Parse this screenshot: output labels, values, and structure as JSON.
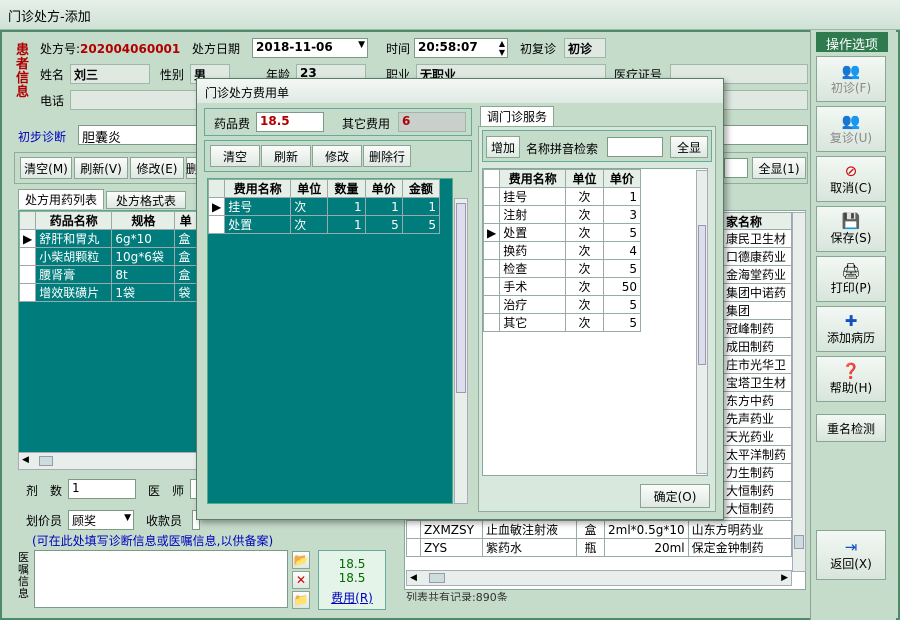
{
  "window": {
    "title": "门诊处方-添加"
  },
  "patient_info_vertical": "患者信息",
  "header": {
    "rx_no_label": "处方号:",
    "rx_no": "202004060001",
    "date_label": "处方日期",
    "date": "2018-11-06",
    "time_label": "时间",
    "time": "20:58:07",
    "visit_type_label": "初复诊",
    "visit_type": "初诊",
    "name_label": "姓名",
    "name": "刘三",
    "gender_label": "性别",
    "gender": "男",
    "age_label": "年龄",
    "age": "23",
    "job_label": "职业",
    "job": "无职业",
    "med_card_label": "医疗证号",
    "phone_label": "电话"
  },
  "diagnosis": {
    "label": "初步诊断",
    "value": "胆囊炎"
  },
  "main_toolbar": {
    "clear": "清空(M)",
    "refresh": "刷新(V)",
    "edit": "修改(E)",
    "more": "删",
    "show_all": "全显(1)"
  },
  "tabs": [
    "处方用药列表",
    "处方格式表"
  ],
  "drug_table": {
    "headers": [
      "药品名称",
      "规格",
      "单"
    ],
    "rows": [
      [
        "舒肝和胃丸",
        "6g*10",
        "盒"
      ],
      [
        "小柴胡颗粒",
        "10g*6袋",
        "盒"
      ],
      [
        "腰肾膏",
        "8t",
        "盒"
      ],
      [
        "增效联磺片",
        "1袋",
        "袋"
      ]
    ]
  },
  "bottom_form": {
    "dose_label": "剂　数",
    "dose": "1",
    "doctor_label": "医　师",
    "pricer_label": "划价员",
    "pricer": "顾奖",
    "cashier_label": "收款员"
  },
  "hint": "(可在此处填写诊断信息或医嘱信息,以供备案)",
  "advice_label": "医嘱信息",
  "fee_summary": {
    "line1": "18.5",
    "line2": "18.5",
    "button": "费用(R)"
  },
  "right_table": {
    "header_partial": "家名称",
    "vendor_rows": [
      "康民卫生材",
      "口德康药业",
      "金海堂药业",
      "集团中诺药",
      "集团",
      "冠峰制药",
      "成田制药",
      "庄市光华卫",
      "宝塔卫生材",
      "东方中药",
      "先声药业",
      "天光药业",
      "太平洋制药",
      "力生制药",
      "大恒制药",
      "大恒制药"
    ],
    "full_rows": [
      {
        "code": "ZXMZSY",
        "name": "止血敏注射液",
        "unit": "盒",
        "spec": "2ml*0.5g*10",
        "vendor": "山东方明药业"
      },
      {
        "code": "ZYS",
        "name": "紫药水",
        "unit": "瓶",
        "spec": "20ml",
        "vendor": "保定金钟制药"
      }
    ],
    "footer": "列表共有记录:890条"
  },
  "side_panel": {
    "title": "操作选项",
    "buttons": [
      {
        "label": "初诊(F)",
        "icon": "people-icon",
        "enabled": false
      },
      {
        "label": "复诊(U)",
        "icon": "people-icon",
        "enabled": false
      },
      {
        "label": "取消(C)",
        "icon": "cancel-icon",
        "enabled": true
      },
      {
        "label": "保存(S)",
        "icon": "save-icon",
        "enabled": true
      },
      {
        "label": "打印(P)",
        "icon": "printer-icon",
        "enabled": true
      },
      {
        "label": "添加病历",
        "icon": "plus-icon",
        "enabled": true
      },
      {
        "label": "帮助(H)",
        "icon": "help-icon",
        "enabled": true
      },
      {
        "label": "重名检测",
        "icon": "",
        "enabled": true
      },
      {
        "label": "返回(X)",
        "icon": "exit-icon",
        "enabled": true
      }
    ]
  },
  "dialog": {
    "title": "门诊处方费用单",
    "drug_fee_label": "药品费",
    "drug_fee": "18.5",
    "other_fee_label": "其它费用",
    "other_fee": "6",
    "toolbar": {
      "clear": "清空",
      "refresh": "刷新",
      "edit": "修改",
      "delete_row": "删除行"
    },
    "fee_table": {
      "headers": [
        "费用名称",
        "单位",
        "数量",
        "单价",
        "金额"
      ],
      "rows": [
        [
          "挂号",
          "次",
          "1",
          "1",
          "1"
        ],
        [
          "处置",
          "次",
          "1",
          "5",
          "5"
        ]
      ]
    },
    "service_tab": "调门诊服务",
    "add": "增加",
    "search_label": "名称拼音检索",
    "show_all": "全显",
    "service_table": {
      "headers": [
        "费用名称",
        "单位",
        "单价"
      ],
      "rows": [
        [
          "挂号",
          "次",
          "1"
        ],
        [
          "注射",
          "次",
          "3"
        ],
        [
          "处置",
          "次",
          "5"
        ],
        [
          "换药",
          "次",
          "4"
        ],
        [
          "检查",
          "次",
          "5"
        ],
        [
          "手术",
          "次",
          "50"
        ],
        [
          "治疗",
          "次",
          "5"
        ],
        [
          "其它",
          "次",
          "5"
        ]
      ]
    },
    "ok": "确定(O)"
  },
  "colors": {
    "teal": "#007c7c",
    "frame": "#4f8a68",
    "accent_red": "#b00000"
  }
}
